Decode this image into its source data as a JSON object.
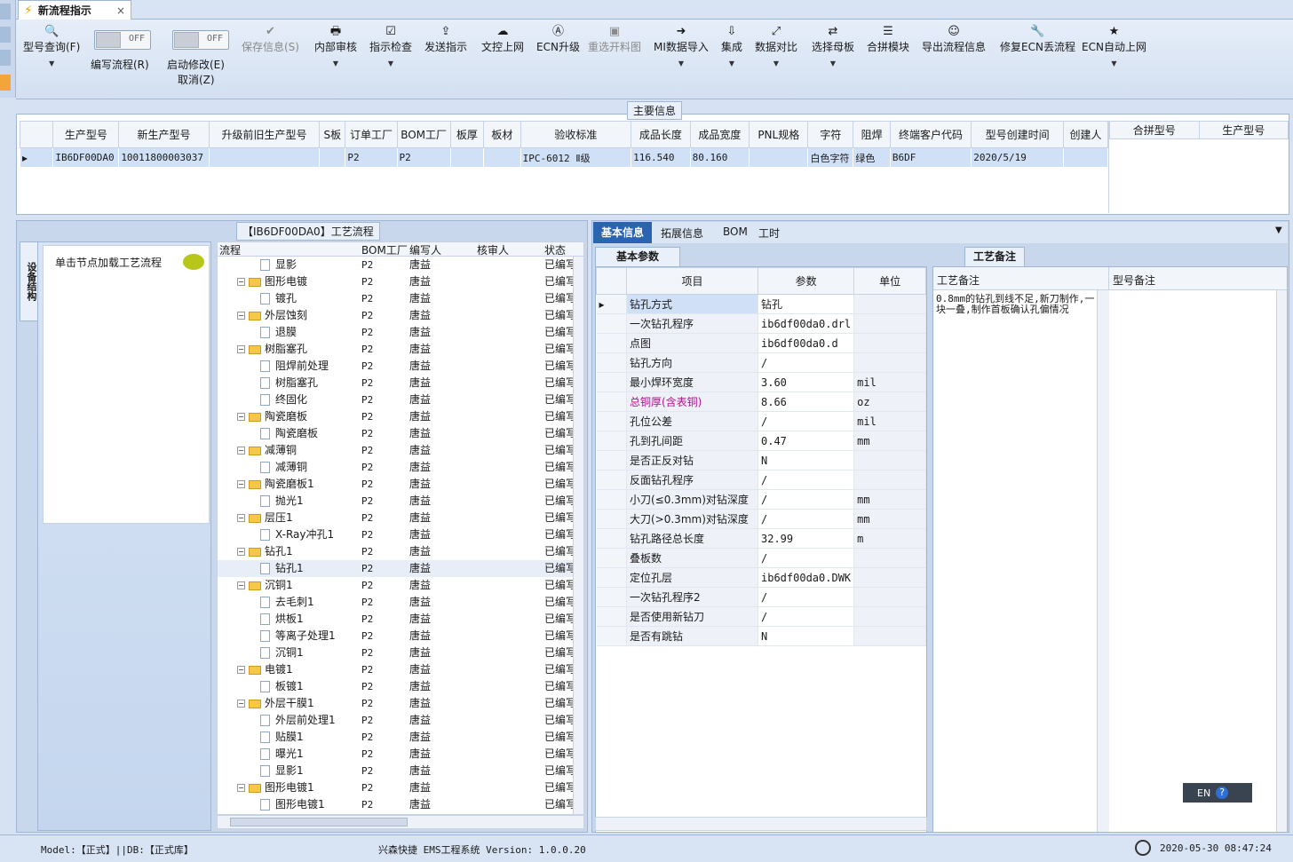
{
  "window": {
    "tab_title": "新流程指示",
    "tab_close": "×"
  },
  "ribbon": {
    "items": [
      {
        "label": "型号查询(F)",
        "icon": "search-icon",
        "glyph": "🔍"
      },
      {
        "label": "保存信息(S)",
        "icon": "save-icon",
        "glyph": "✔"
      },
      {
        "label": "内部审核",
        "icon": "print-icon",
        "glyph": "🖶"
      },
      {
        "label": "指示检查",
        "icon": "check-icon",
        "glyph": "☑"
      },
      {
        "label": "发送指示",
        "icon": "upload-icon",
        "glyph": "⇪"
      },
      {
        "label": "文控上网",
        "icon": "cloud-icon",
        "glyph": "☁"
      },
      {
        "label": "ECN升级",
        "icon": "ecn-icon",
        "glyph": "Ⓐ"
      },
      {
        "label": "重选开料图",
        "icon": "image-icon",
        "glyph": "▣"
      },
      {
        "label": "MI数据导入",
        "icon": "import-icon",
        "glyph": "➜"
      },
      {
        "label": "集成",
        "icon": "download-icon",
        "glyph": "⇩"
      },
      {
        "label": "数据对比",
        "icon": "compare-icon",
        "glyph": "⤢"
      },
      {
        "label": "选择母板",
        "icon": "shuffle-icon",
        "glyph": "⇄"
      },
      {
        "label": "合拼模块",
        "icon": "list-icon",
        "glyph": "☰"
      },
      {
        "label": "导出流程信息",
        "icon": "smile-icon",
        "glyph": "☺"
      },
      {
        "label": "修复ECN丢流程",
        "icon": "wrench-icon",
        "glyph": "🔧"
      },
      {
        "label": "ECN自动上网",
        "icon": "star-icon",
        "glyph": "★"
      }
    ],
    "toggle_edit": {
      "label": "编写流程(R)",
      "state": "OFF"
    },
    "toggle_modify": {
      "label": "启动修改(E)",
      "state": "OFF",
      "sub": "取消(Z)"
    }
  },
  "main_info": {
    "group_title": "主要信息",
    "columns": [
      "生产型号",
      "新生产型号",
      "升级前旧生产型号",
      "S板",
      "订单工厂",
      "BOM工厂",
      "板厚",
      "板材",
      "验收标准",
      "成品长度",
      "成品宽度",
      "PNL规格",
      "字符",
      "阻焊",
      "终端客户代码",
      "型号创建时间",
      "创建人"
    ],
    "row": [
      "IB6DF00DA0",
      "10011800003037",
      "",
      "",
      "P2",
      "P2",
      "",
      "",
      "IPC-6012 Ⅱ级",
      "116.540",
      "80.160",
      "",
      "白色字符",
      "绿色",
      "B6DF",
      "2020/5/19",
      ""
    ],
    "side_columns": [
      "合拼型号",
      "生产型号"
    ]
  },
  "flow_panel": {
    "group_title": "【IB6DF00DA0】工艺流程",
    "side_tab": "设备结构",
    "hint": "单击节点加载工艺流程",
    "columns": [
      "流程",
      "BOM工厂",
      "编写人",
      "核审人",
      "状态"
    ],
    "rows": [
      {
        "name": "显影",
        "level": 1,
        "bom": "P2",
        "author": "唐益",
        "status": "已编写"
      },
      {
        "name": "图形电镀",
        "level": 0,
        "bom": "P2",
        "author": "唐益",
        "status": "已编写"
      },
      {
        "name": "镀孔",
        "level": 1,
        "bom": "P2",
        "author": "唐益",
        "status": "已编写"
      },
      {
        "name": "外层蚀刻",
        "level": 0,
        "bom": "P2",
        "author": "唐益",
        "status": "已编写"
      },
      {
        "name": "退膜",
        "level": 1,
        "bom": "P2",
        "author": "唐益",
        "status": "已编写"
      },
      {
        "name": "树脂塞孔",
        "level": 0,
        "bom": "P2",
        "author": "唐益",
        "status": "已编写"
      },
      {
        "name": "阻焊前处理",
        "level": 1,
        "bom": "P2",
        "author": "唐益",
        "status": "已编写"
      },
      {
        "name": "树脂塞孔",
        "level": 1,
        "bom": "P2",
        "author": "唐益",
        "status": "已编写"
      },
      {
        "name": "终固化",
        "level": 1,
        "bom": "P2",
        "author": "唐益",
        "status": "已编写"
      },
      {
        "name": "陶瓷磨板",
        "level": 0,
        "bom": "P2",
        "author": "唐益",
        "status": "已编写"
      },
      {
        "name": "陶瓷磨板",
        "level": 1,
        "bom": "P2",
        "author": "唐益",
        "status": "已编写"
      },
      {
        "name": "减薄铜",
        "level": 0,
        "bom": "P2",
        "author": "唐益",
        "status": "已编写"
      },
      {
        "name": "减薄铜",
        "level": 1,
        "bom": "P2",
        "author": "唐益",
        "status": "已编写"
      },
      {
        "name": "陶瓷磨板1",
        "level": 0,
        "bom": "P2",
        "author": "唐益",
        "status": "已编写"
      },
      {
        "name": "抛光1",
        "level": 1,
        "bom": "P2",
        "author": "唐益",
        "status": "已编写"
      },
      {
        "name": "层压1",
        "level": 0,
        "bom": "P2",
        "author": "唐益",
        "status": "已编写"
      },
      {
        "name": "X-Ray冲孔1",
        "level": 1,
        "bom": "P2",
        "author": "唐益",
        "status": "已编写"
      },
      {
        "name": "钻孔1",
        "level": 0,
        "bom": "P2",
        "author": "唐益",
        "status": "已编写"
      },
      {
        "name": "钻孔1",
        "level": 1,
        "bom": "P2",
        "author": "唐益",
        "status": "已编写",
        "selected": true
      },
      {
        "name": "沉铜1",
        "level": 0,
        "bom": "P2",
        "author": "唐益",
        "status": "已编写"
      },
      {
        "name": "去毛刺1",
        "level": 1,
        "bom": "P2",
        "author": "唐益",
        "status": "已编写"
      },
      {
        "name": "烘板1",
        "level": 1,
        "bom": "P2",
        "author": "唐益",
        "status": "已编写"
      },
      {
        "name": "等离子处理1",
        "level": 1,
        "bom": "P2",
        "author": "唐益",
        "status": "已编写"
      },
      {
        "name": "沉铜1",
        "level": 1,
        "bom": "P2",
        "author": "唐益",
        "status": "已编写"
      },
      {
        "name": "电镀1",
        "level": 0,
        "bom": "P2",
        "author": "唐益",
        "status": "已编写"
      },
      {
        "name": "板镀1",
        "level": 1,
        "bom": "P2",
        "author": "唐益",
        "status": "已编写"
      },
      {
        "name": "外层干膜1",
        "level": 0,
        "bom": "P2",
        "author": "唐益",
        "status": "已编写"
      },
      {
        "name": "外层前处理1",
        "level": 1,
        "bom": "P2",
        "author": "唐益",
        "status": "已编写"
      },
      {
        "name": "贴膜1",
        "level": 1,
        "bom": "P2",
        "author": "唐益",
        "status": "已编写"
      },
      {
        "name": "曝光1",
        "level": 1,
        "bom": "P2",
        "author": "唐益",
        "status": "已编写"
      },
      {
        "name": "显影1",
        "level": 1,
        "bom": "P2",
        "author": "唐益",
        "status": "已编写"
      },
      {
        "name": "图形电镀1",
        "level": 0,
        "bom": "P2",
        "author": "唐益",
        "status": "已编写"
      },
      {
        "name": "图形电镀1",
        "level": 1,
        "bom": "P2",
        "author": "唐益",
        "status": "已编写"
      }
    ]
  },
  "detail": {
    "tabs": [
      "基本信息",
      "拓展信息",
      "BOM",
      "工时"
    ],
    "subtab": "基本参数",
    "columns": [
      "项目",
      "参数",
      "单位"
    ],
    "rows": [
      {
        "item": "钻孔方式",
        "value": "钻孔",
        "unit": ""
      },
      {
        "item": "一次钻孔程序",
        "value": "ib6df00da0.drl",
        "unit": ""
      },
      {
        "item": "点图",
        "value": "ib6df00da0.d",
        "unit": ""
      },
      {
        "item": "钻孔方向",
        "value": "/",
        "unit": ""
      },
      {
        "item": "最小焊环宽度",
        "value": "3.60",
        "unit": "mil"
      },
      {
        "item": "总铜厚(含表铜)",
        "value": "8.66",
        "unit": "oz",
        "highlight": true
      },
      {
        "item": "孔位公差",
        "value": "/",
        "unit": "mil"
      },
      {
        "item": "孔到孔间距",
        "value": "0.47",
        "unit": "mm"
      },
      {
        "item": "是否正反对钻",
        "value": "N",
        "unit": ""
      },
      {
        "item": "反面钻孔程序",
        "value": "/",
        "unit": ""
      },
      {
        "item": "小刀(≤0.3mm)对钻深度",
        "value": "/",
        "unit": "mm"
      },
      {
        "item": "大刀(>0.3mm)对钻深度",
        "value": "/",
        "unit": "mm"
      },
      {
        "item": "钻孔路径总长度",
        "value": "32.99",
        "unit": "m"
      },
      {
        "item": "叠板数",
        "value": "/",
        "unit": ""
      },
      {
        "item": "定位孔层",
        "value": "ib6df00da0.DWK",
        "unit": ""
      },
      {
        "item": "一次钻孔程序2",
        "value": "/",
        "unit": ""
      },
      {
        "item": "是否使用新钻刀",
        "value": "/",
        "unit": ""
      },
      {
        "item": "是否有跳钻",
        "value": "N",
        "unit": ""
      }
    ]
  },
  "remarks": {
    "tab": "工艺备注",
    "col1": "工艺备注",
    "col2": "型号备注",
    "text": "0.8mm的钻孔到线不足,新刀制作,一块一叠,制作首板确认孔偏情况"
  },
  "ime": {
    "lang": "EN",
    "help": "?"
  },
  "status": {
    "model": "Model:【正式】||DB:【正式库】",
    "system": "兴森快捷 EMS工程系统 Version: 1.0.0.20",
    "datetime": "2020-05-30 08:47:24"
  },
  "colors": {
    "accent": "#1f5fa8",
    "highlight_text": "#b01090",
    "selected_row": "#cfe0f7"
  }
}
